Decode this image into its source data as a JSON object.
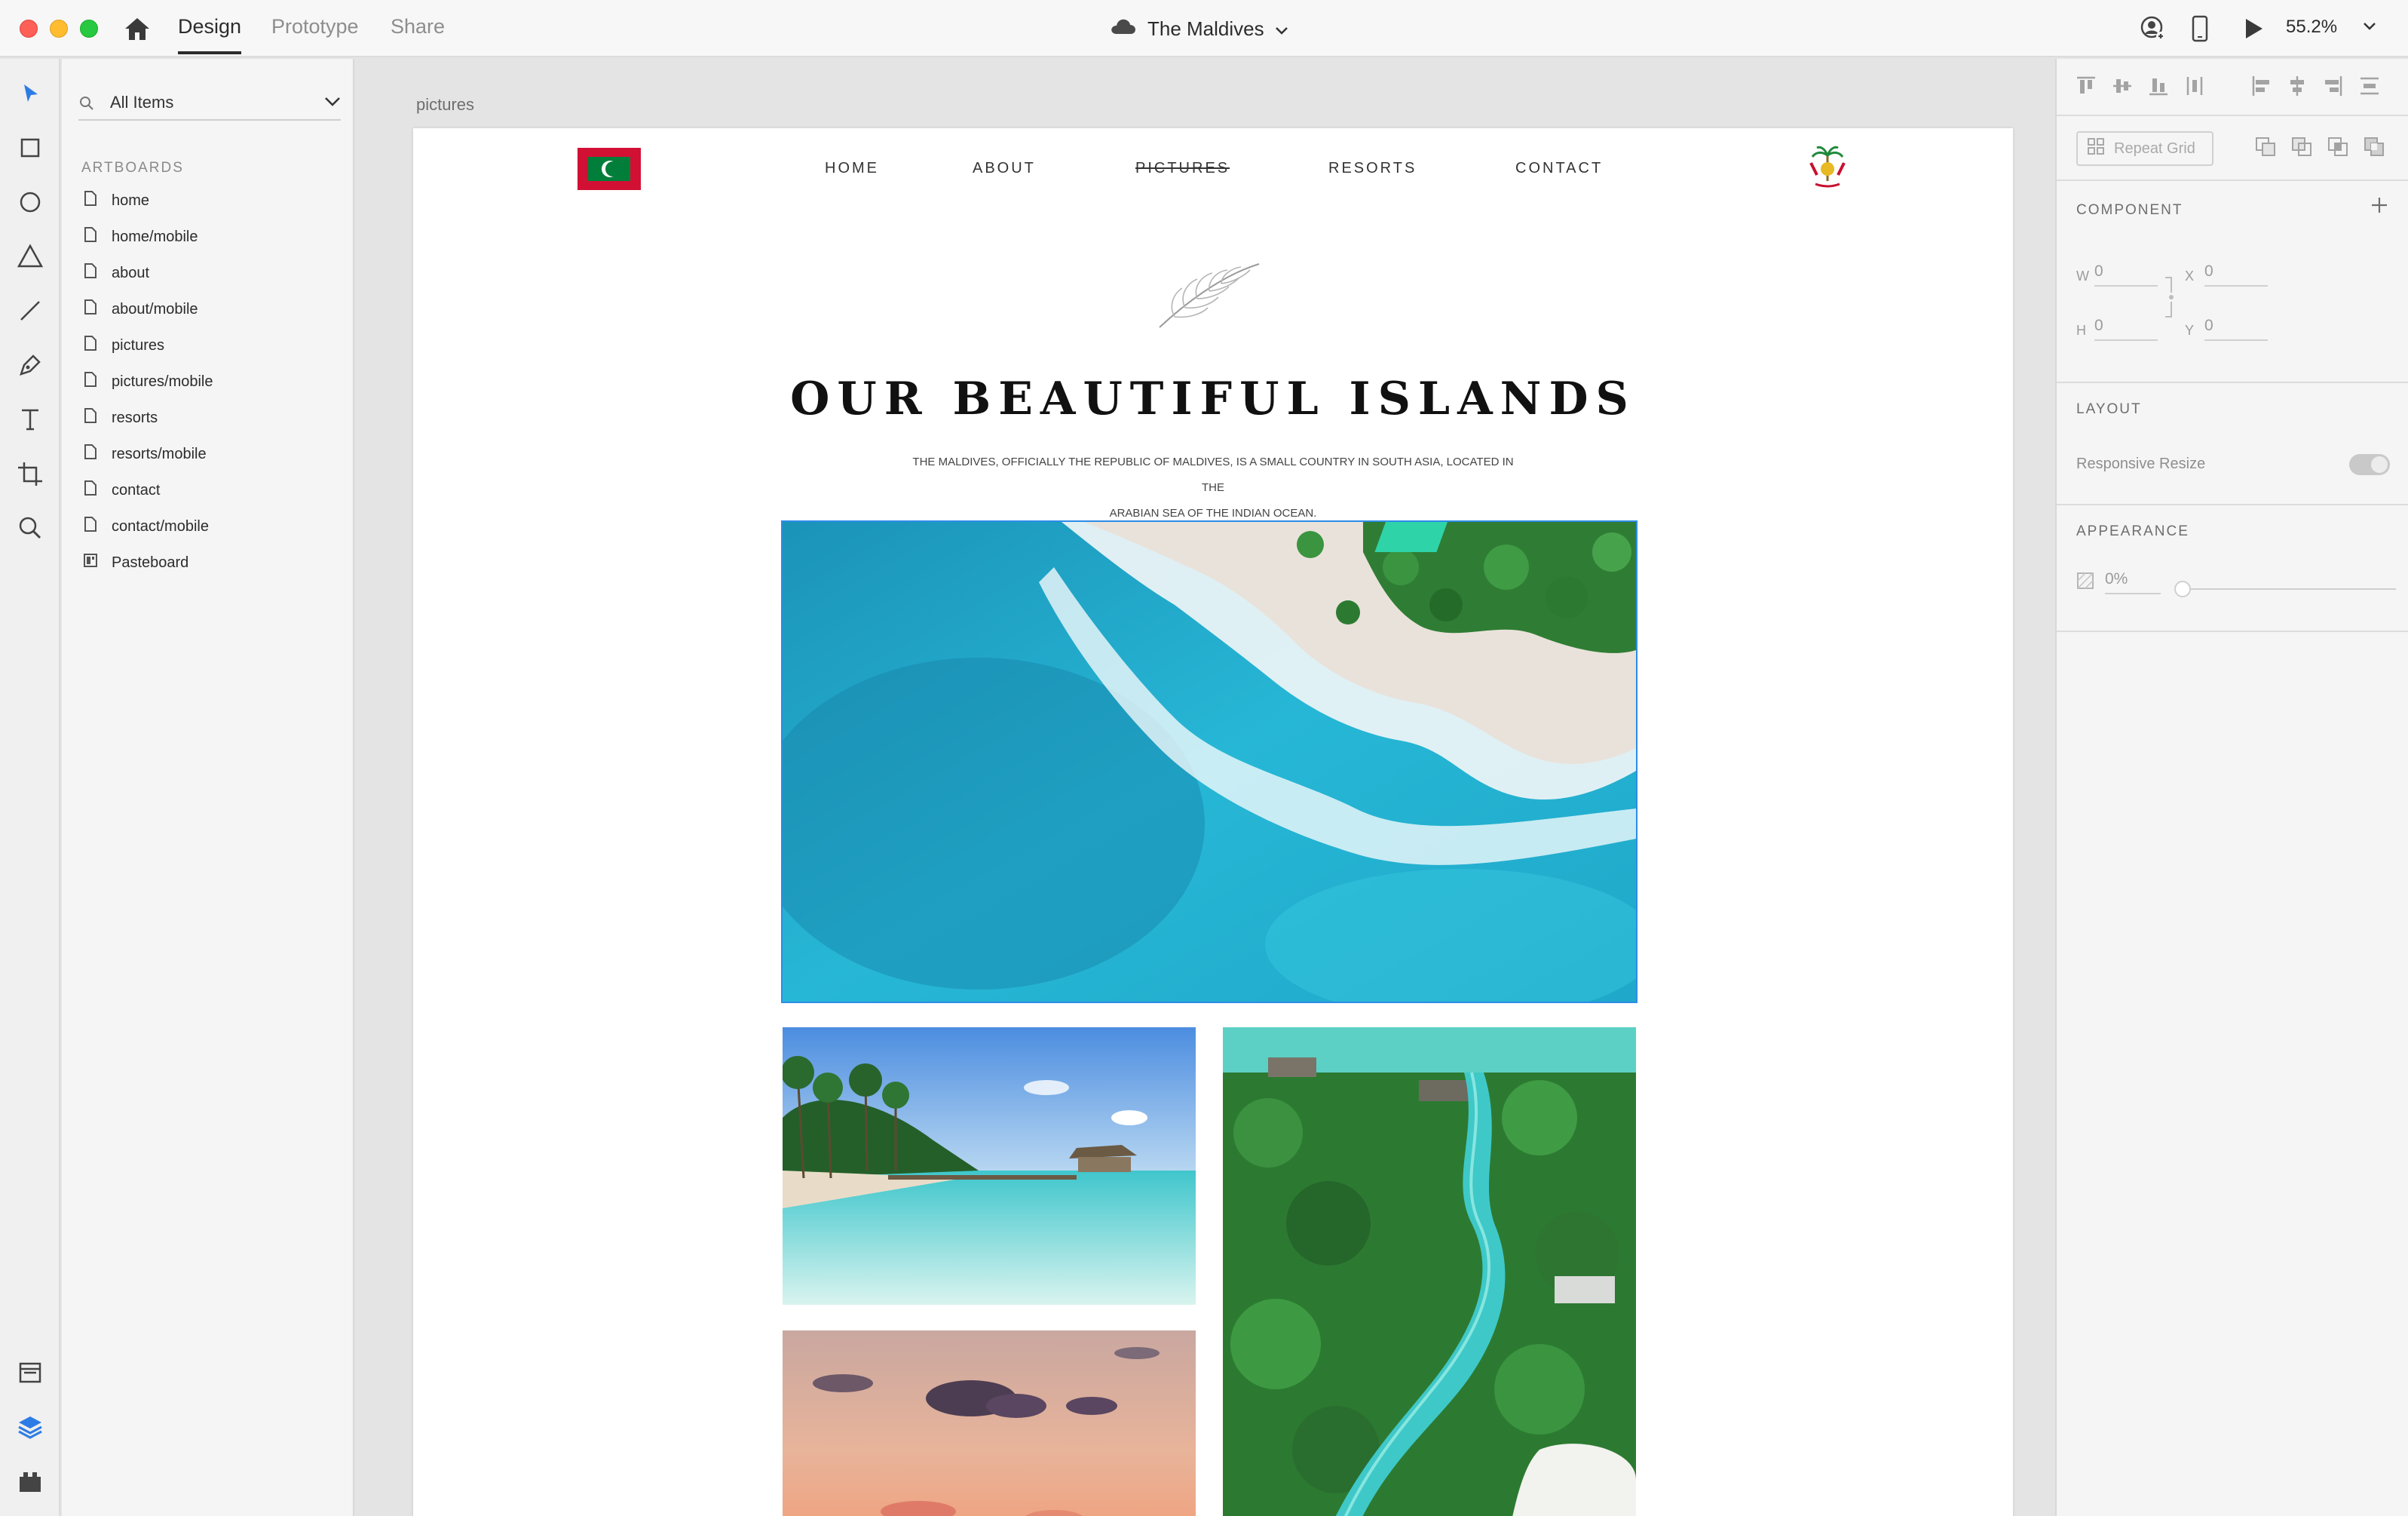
{
  "titlebar": {
    "tabs": [
      "Design",
      "Prototype",
      "Share"
    ],
    "active_tab": "Design",
    "document_title": "The Maldives",
    "zoom": "55.2%"
  },
  "tools": [
    "select-tool",
    "rectangle-tool",
    "ellipse-tool",
    "polygon-tool",
    "line-tool",
    "pen-tool",
    "text-tool",
    "artboard-tool",
    "zoom-tool",
    "assets-panel",
    "layers-panel",
    "plugins-panel"
  ],
  "layers_panel": {
    "filter_value": "All Items",
    "section_title": "ARTBOARDS",
    "items": [
      {
        "label": "home",
        "icon": "page-icon"
      },
      {
        "label": "home/mobile",
        "icon": "page-icon"
      },
      {
        "label": "about",
        "icon": "page-icon"
      },
      {
        "label": "about/mobile",
        "icon": "page-icon"
      },
      {
        "label": "pictures",
        "icon": "page-icon"
      },
      {
        "label": "pictures/mobile",
        "icon": "page-icon"
      },
      {
        "label": "resorts",
        "icon": "page-icon"
      },
      {
        "label": "resorts/mobile",
        "icon": "page-icon"
      },
      {
        "label": "contact",
        "icon": "page-icon"
      },
      {
        "label": "contact/mobile",
        "icon": "page-icon"
      },
      {
        "label": "Pasteboard",
        "icon": "pasteboard-icon"
      }
    ]
  },
  "canvas": {
    "artboard_label": "pictures",
    "nav": [
      "HOME",
      "ABOUT",
      "PICTURES",
      "RESORTS",
      "CONTACT"
    ],
    "current_nav": "PICTURES",
    "title": "OUR BEAUTIFUL ISLANDS",
    "subtitle_line1": "THE MALDIVES, OFFICIALLY THE REPUBLIC OF MALDIVES, IS A SMALL COUNTRY IN SOUTH ASIA, LOCATED IN THE",
    "subtitle_line2": "ARABIAN SEA OF THE INDIAN OCEAN."
  },
  "inspector": {
    "repeat_grid_label": "Repeat Grid",
    "component_title": "COMPONENT",
    "w_label": "W",
    "w_value": "0",
    "h_label": "H",
    "h_value": "0",
    "x_label": "X",
    "x_value": "0",
    "y_label": "Y",
    "y_value": "0",
    "layout_title": "LAYOUT",
    "responsive_label": "Responsive Resize",
    "appearance_title": "APPEARANCE",
    "opacity_value": "0%"
  },
  "colors": {
    "accent": "#2d8ce8",
    "flag_red": "#d21034",
    "flag_green": "#007e3a"
  }
}
